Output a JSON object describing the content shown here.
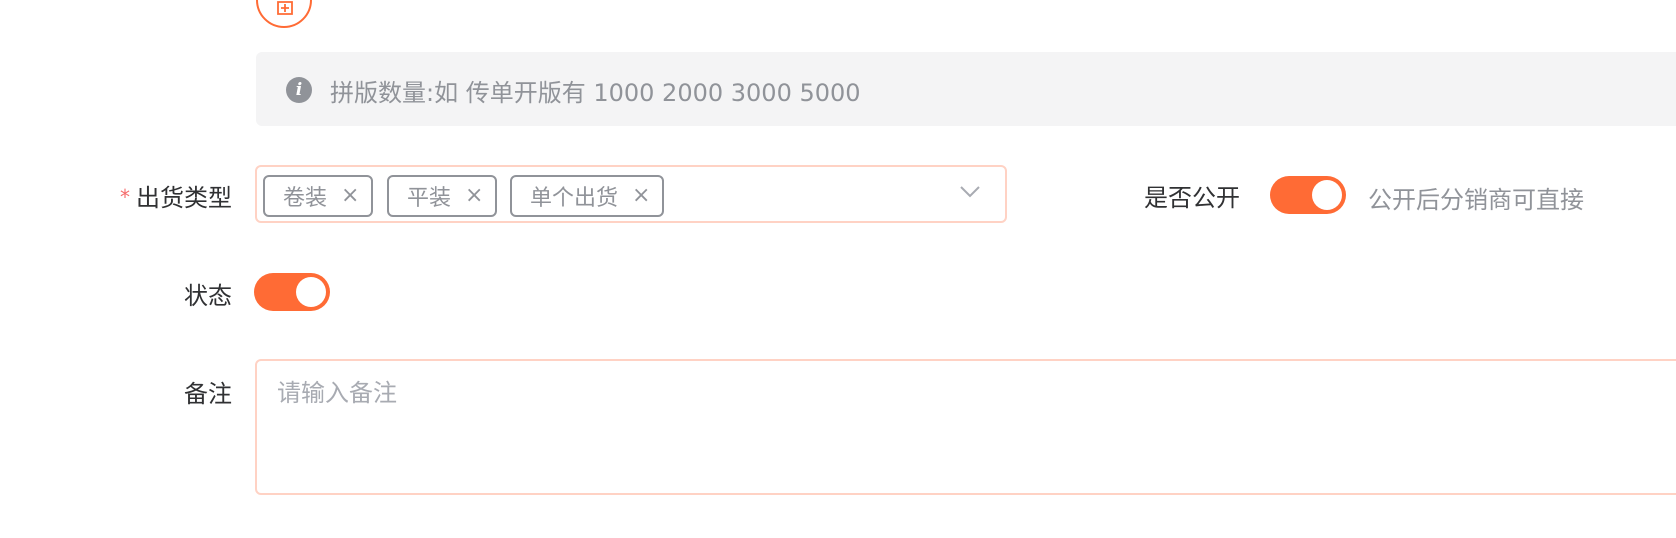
{
  "upload": {
    "icon": "add-file-icon"
  },
  "info": {
    "icon": "info-circle-icon",
    "text": "拼版数量:如 传单开版有 1000 2000 3000 5000"
  },
  "form": {
    "shipping_type": {
      "required_mark": "*",
      "label": "出货类型",
      "tags": [
        {
          "label": "卷装",
          "close": "×"
        },
        {
          "label": "平装",
          "close": "×"
        },
        {
          "label": "单个出货",
          "close": "×"
        }
      ]
    },
    "is_public": {
      "label": "是否公开",
      "value": true,
      "hint": "公开后分销商可直接"
    },
    "status": {
      "label": "状态",
      "value": true
    },
    "remark": {
      "label": "备注",
      "placeholder": "请输入备注",
      "value": ""
    }
  },
  "colors": {
    "accent": "#ff6b35",
    "required": "#f56c6c",
    "muted_text": "#909399",
    "input_border": "#ffd2c4",
    "info_bg": "#f4f4f5"
  }
}
